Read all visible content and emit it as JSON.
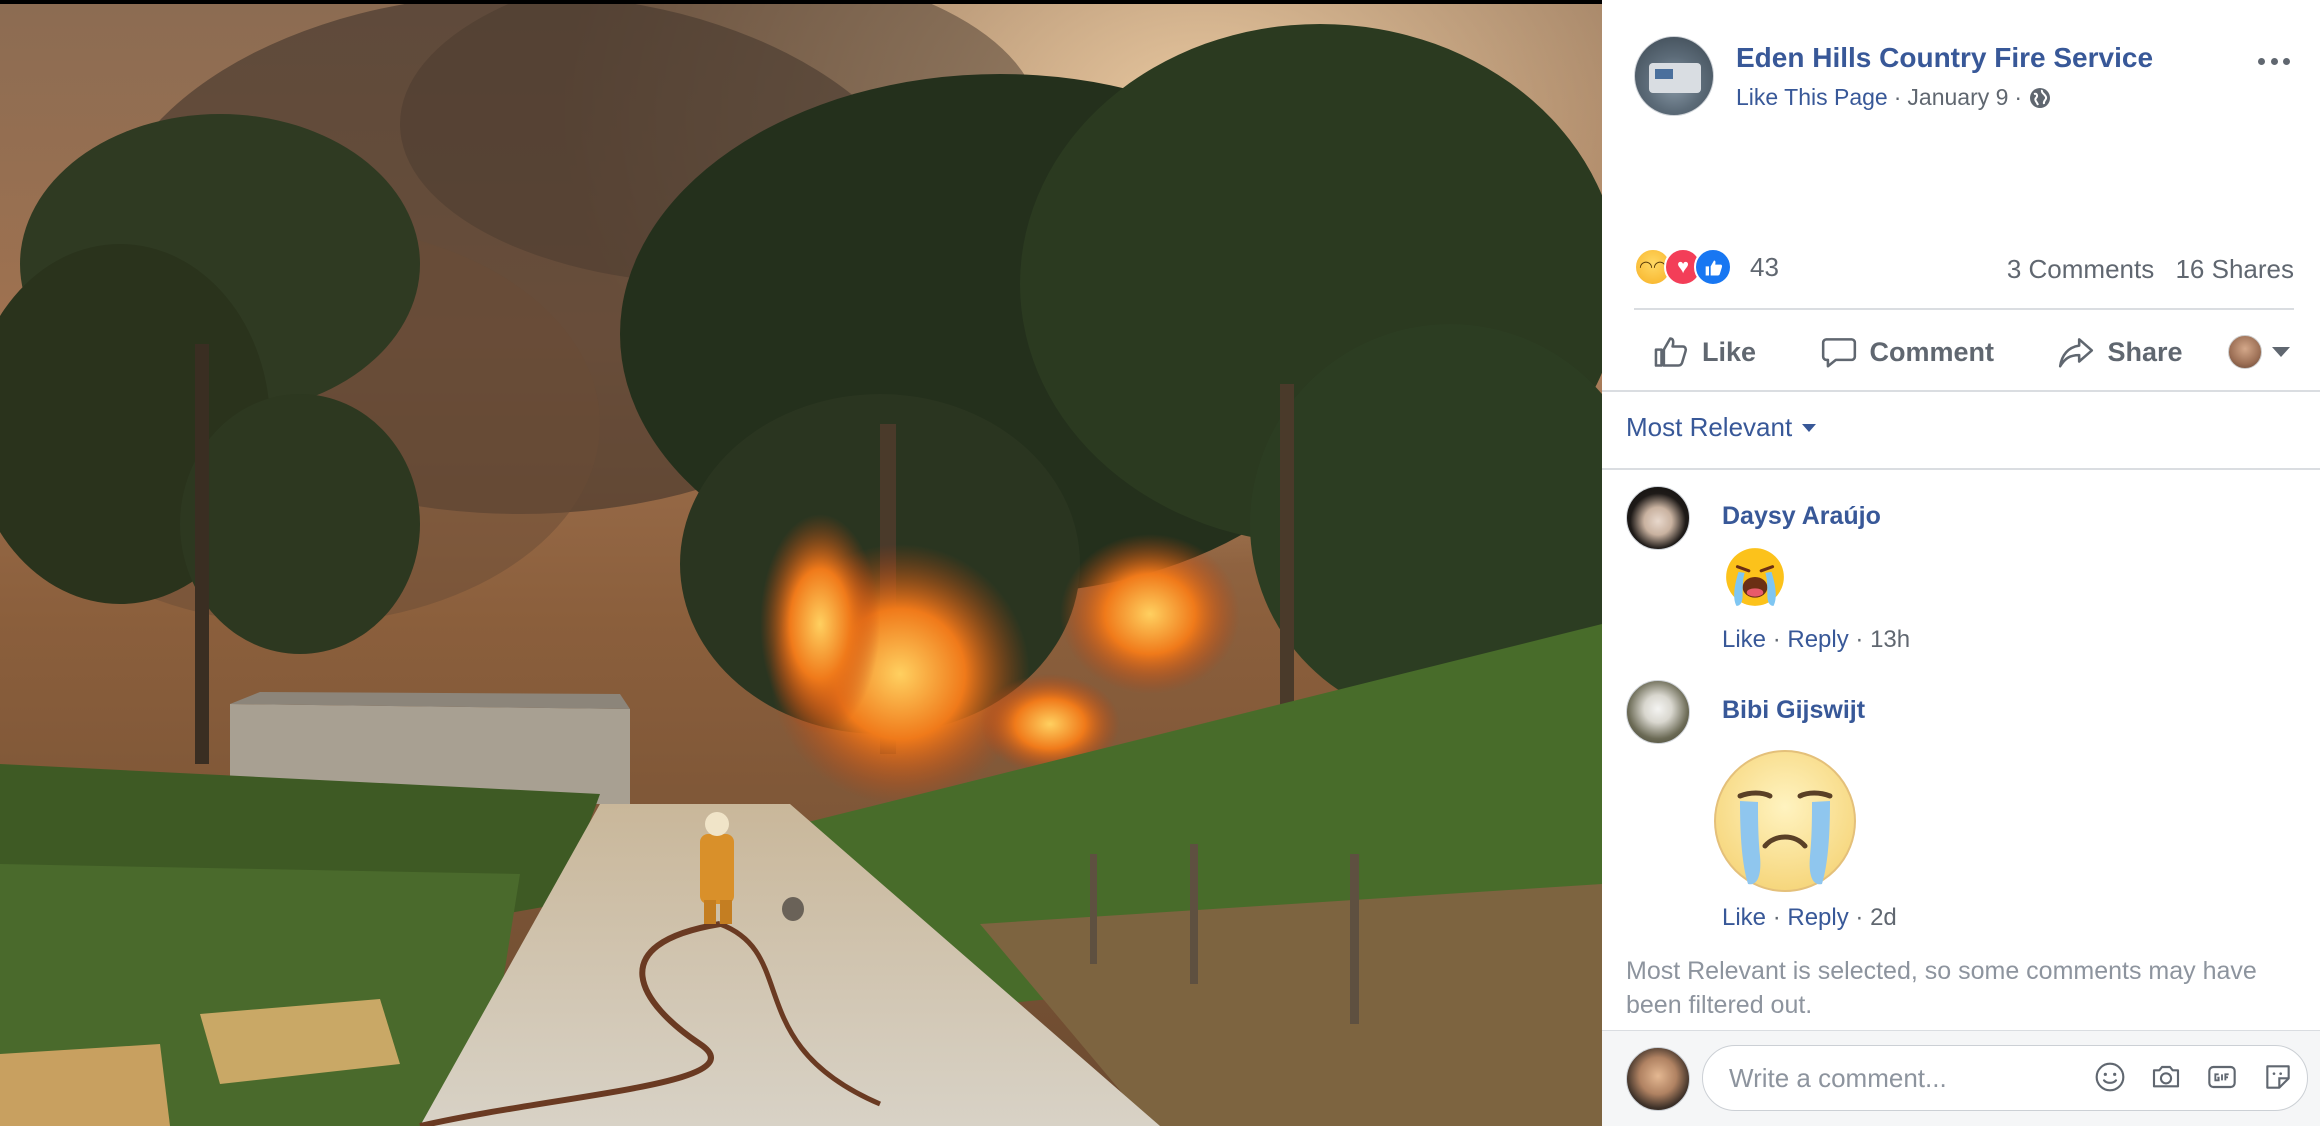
{
  "post": {
    "page_name": "Eden Hills Country Fire Service",
    "like_page_label": "Like This Page",
    "separator": "·",
    "date": "January 9"
  },
  "stats": {
    "reaction_count": "43",
    "comments": "3 Comments",
    "shares": "16 Shares",
    "reaction_types": [
      "sad",
      "love",
      "like"
    ]
  },
  "actions": {
    "like": "Like",
    "comment": "Comment",
    "share": "Share"
  },
  "comments_section": {
    "sort_label": "Most Relevant",
    "items": [
      {
        "author": "Daysy Araújo",
        "like": "Like",
        "reply": "Reply",
        "time": "13h",
        "content": "loudly-crying-face-emoji"
      },
      {
        "author": "Bibi Gijswijt",
        "like": "Like",
        "reply": "Reply",
        "time": "2d",
        "content": "crying-face-sticker"
      }
    ],
    "filter_note": "Most Relevant is selected, so some comments may have been filtered out."
  },
  "composer": {
    "placeholder": "Write a comment...",
    "icons": [
      "emoji-icon",
      "camera-icon",
      "gif-icon",
      "sticker-icon"
    ]
  },
  "colors": {
    "link_blue": "#385898",
    "meta_gray": "#606770",
    "like_blue": "#1877f2",
    "love_red": "#f33e58"
  }
}
